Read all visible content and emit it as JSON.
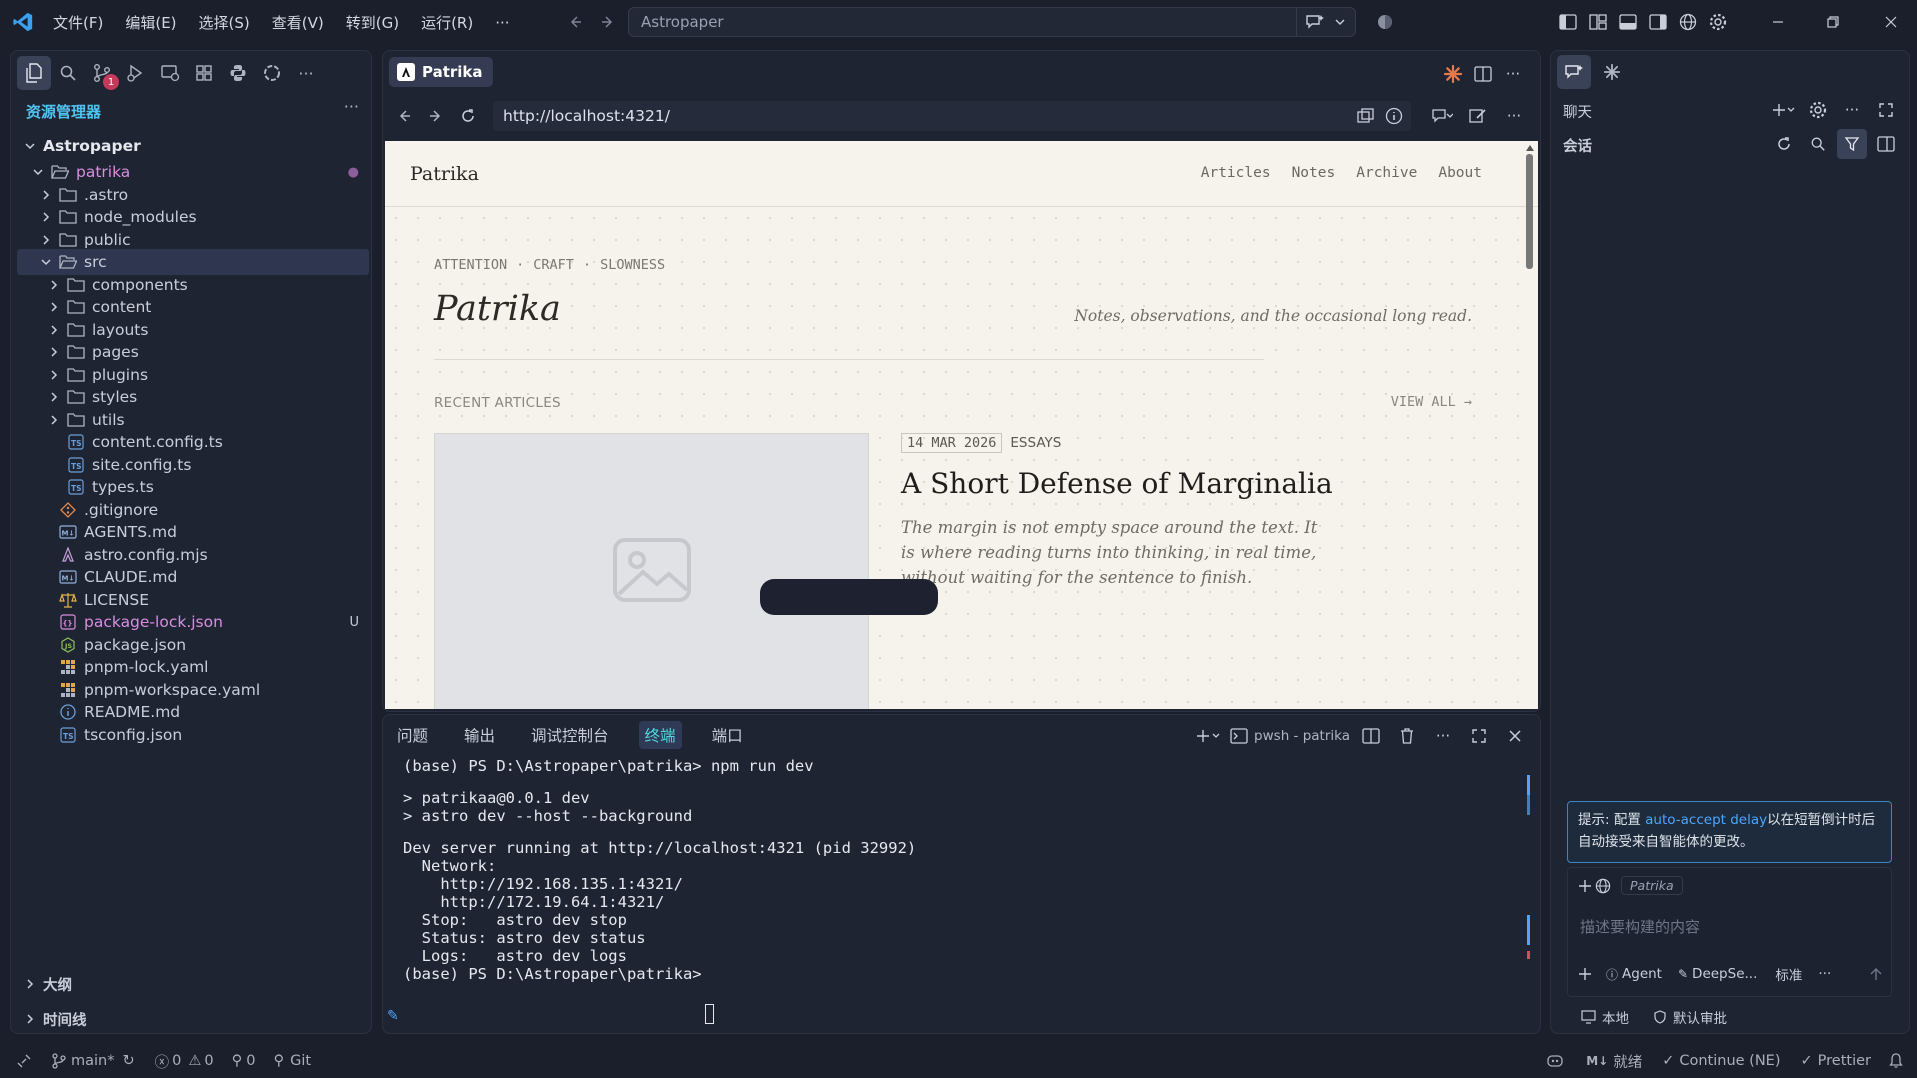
{
  "titlebar": {
    "menus": [
      "文件(F)",
      "编辑(E)",
      "选择(S)",
      "查看(V)",
      "转到(G)",
      "运行(R)",
      "···"
    ],
    "command_center": "Astropaper"
  },
  "sidebar": {
    "title": "资源管理器",
    "more": "···",
    "workspace": "Astropaper",
    "scm_badge": "1",
    "tree": [
      {
        "label": "patrika",
        "depth": 1,
        "kind": "folder-open",
        "mod": true,
        "flag": "●"
      },
      {
        "label": ".astro",
        "depth": 2,
        "kind": "folder"
      },
      {
        "label": "node_modules",
        "depth": 2,
        "kind": "folder"
      },
      {
        "label": "public",
        "depth": 2,
        "kind": "folder"
      },
      {
        "label": "src",
        "depth": 2,
        "kind": "folder-open",
        "selected": true
      },
      {
        "label": "components",
        "depth": 3,
        "kind": "folder"
      },
      {
        "label": "content",
        "depth": 3,
        "kind": "folder"
      },
      {
        "label": "layouts",
        "depth": 3,
        "kind": "folder"
      },
      {
        "label": "pages",
        "depth": 3,
        "kind": "folder"
      },
      {
        "label": "plugins",
        "depth": 3,
        "kind": "folder"
      },
      {
        "label": "styles",
        "depth": 3,
        "kind": "folder"
      },
      {
        "label": "utils",
        "depth": 3,
        "kind": "folder"
      },
      {
        "label": "content.config.ts",
        "depth": 3,
        "kind": "ts"
      },
      {
        "label": "site.config.ts",
        "depth": 3,
        "kind": "ts"
      },
      {
        "label": "types.ts",
        "depth": 3,
        "kind": "ts"
      },
      {
        "label": ".gitignore",
        "depth": 2,
        "kind": "git"
      },
      {
        "label": "AGENTS.md",
        "depth": 2,
        "kind": "md"
      },
      {
        "label": "astro.config.mjs",
        "depth": 2,
        "kind": "astro"
      },
      {
        "label": "CLAUDE.md",
        "depth": 2,
        "kind": "md"
      },
      {
        "label": "LICENSE",
        "depth": 2,
        "kind": "license"
      },
      {
        "label": "package-lock.json",
        "depth": 2,
        "kind": "json",
        "mod": true,
        "flag": "U"
      },
      {
        "label": "package.json",
        "depth": 2,
        "kind": "node"
      },
      {
        "label": "pnpm-lock.yaml",
        "depth": 2,
        "kind": "pnpm"
      },
      {
        "label": "pnpm-workspace.yaml",
        "depth": 2,
        "kind": "pnpm"
      },
      {
        "label": "README.md",
        "depth": 2,
        "kind": "info"
      },
      {
        "label": "tsconfig.json",
        "depth": 2,
        "kind": "ts"
      }
    ],
    "outline": "大纲",
    "timeline": "时间线"
  },
  "editor": {
    "tab_label": "Patrika",
    "url": "http://localhost:4321/"
  },
  "site": {
    "logo": "Patrika",
    "nav": [
      "Articles",
      "Notes",
      "Archive",
      "About"
    ],
    "kicker": [
      "ATTENTION",
      "CRAFT",
      "SLOWNESS"
    ],
    "kicker_sep": "·",
    "title": "Patrika",
    "tagline": "Notes, observations, and the occasional long read.",
    "recent_label": "RECENT ARTICLES",
    "view_all": "VIEW ALL →",
    "article": {
      "date": "14 MAR 2026",
      "category": "ESSAYS",
      "title": "A Short Defense of Marginalia",
      "excerpt_lines": [
        "The margin is not empty space around the text. It",
        "is where reading turns into thinking, in real time,",
        "without waiting for the sentence to finish."
      ]
    }
  },
  "panel": {
    "tabs": [
      "问题",
      "输出",
      "调试控制台",
      "终端",
      "端口"
    ],
    "active_tab": "终端",
    "terminal_name": "pwsh - patrika",
    "terminal_lines": [
      "(base) PS D:\\Astropaper\\patrika> npm run dev",
      "",
      "> patrikaa@0.0.1 dev",
      "> astro dev --host --background",
      "",
      "Dev server running at http://localhost:4321 (pid 32992)",
      "  Network:",
      "    http://192.168.135.1:4321/",
      "    http://172.19.64.1:4321/",
      "  Stop:   astro dev stop",
      "  Status: astro dev status",
      "  Logs:   astro dev logs",
      "(base) PS D:\\Astropaper\\patrika> "
    ]
  },
  "chat": {
    "header": "聊天",
    "sessions": "会话",
    "hint_prefix": "提示: 配置 ",
    "hint_link": "auto-accept delay",
    "hint_suffix": "以在短暂倒计时后自动接受来自智能体的更改。",
    "context_chip": "Patrika",
    "placeholder": "描述要构建的内容",
    "mode": "Agent",
    "model": "DeepSe...",
    "level": "标准",
    "local": "本地",
    "approval": "默认审批"
  },
  "statusbar": {
    "branch": "main*",
    "errors": "0",
    "warnings": "0",
    "ports": "0",
    "git": "Git",
    "md_status": "就绪",
    "continue": "Continue (NE)",
    "prettier": "Prettier"
  },
  "colors": {
    "accent_blue": "#4fc4f0",
    "git_modified": "#d78ee0",
    "badge_red": "#c53a5a",
    "page_bg": "#f5f3ec"
  }
}
